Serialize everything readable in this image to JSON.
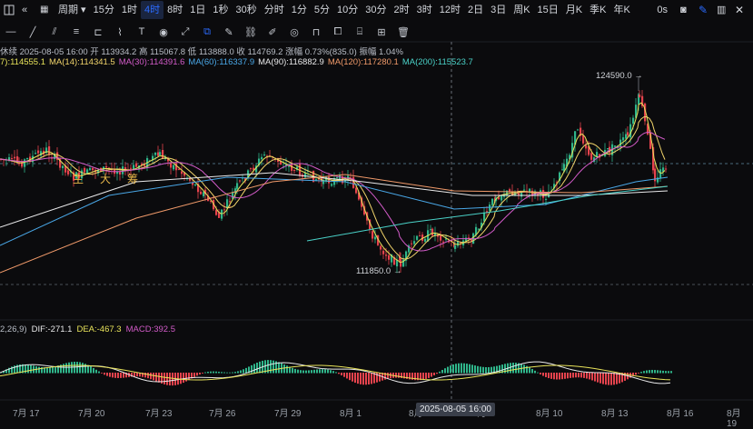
{
  "timeframes": [
    "周期",
    "15分",
    "1时",
    "4时",
    "8时",
    "1日",
    "1秒",
    "30秒",
    "分时",
    "1分",
    "5分",
    "10分",
    "30分",
    "2时",
    "3时",
    "12时",
    "2日",
    "3日",
    "周K",
    "15日",
    "月K",
    "季K",
    "年K"
  ],
  "active_timeframe_index": 3,
  "right_bar": {
    "seconds_label": "0s"
  },
  "info_line": "休续  2025-08-05 16:00  开 113934.2  高 115067.8  低 113888.0  收 114769.2  涨幅 0.73%(835.0)  振幅 1.04%",
  "ma_items": [
    {
      "label": "7):114555.1",
      "color": "#e8e35a"
    },
    {
      "label": "MA(14):114341.5",
      "color": "#f0d36a"
    },
    {
      "label": "MA(30):114391.6",
      "color": "#d25bc8"
    },
    {
      "label": "MA(60):116337.9",
      "color": "#4aa8e8"
    },
    {
      "label": "MA(90):116882.9",
      "color": "#e9e9ea"
    },
    {
      "label": "MA(120):117280.1",
      "color": "#f09a6a"
    },
    {
      "label": "MA(200):115523.7",
      "color": "#4ad2c8"
    }
  ],
  "chips": [
    "主",
    "大",
    "筹"
  ],
  "high_marker": "124590.0",
  "low_marker": "111850.0",
  "macd_items": [
    {
      "label": "2,26,9)",
      "color": "#b9bec7"
    },
    {
      "label": "DIF:-271.1",
      "color": "#e9e9ea"
    },
    {
      "label": "DEA:-467.3",
      "color": "#e8e35a"
    },
    {
      "label": "MACD:392.5",
      "color": "#d25bc8"
    }
  ],
  "x_labels": [
    "7月 17",
    "7月 20",
    "7月 23",
    "7月 26",
    "7月 29",
    "8月 1",
    "8月",
    "8月 7",
    "8月 10",
    "8月 13",
    "8月 16",
    "8月 19"
  ],
  "crosshair_label": "2025-08-05 16:00",
  "colors": {
    "up": "#2fb58a",
    "down": "#e5434d",
    "accent": "#2b6bff"
  },
  "chart_data": {
    "type": "candlestick",
    "title": "",
    "price_markers": {
      "high": 124590.0,
      "low": 111850.0
    },
    "current_bar": {
      "time": "2025-08-05 16:00",
      "open": 113934.2,
      "high": 115067.8,
      "low": 113888.0,
      "close": 114769.2,
      "change_pct": 0.73,
      "change": 835.0,
      "amplitude_pct": 1.04
    },
    "moving_averages": {
      "MA7": 114555.1,
      "MA14": 114341.5,
      "MA30": 114391.6,
      "MA60": 116337.9,
      "MA90": 116882.9,
      "MA120": 117280.1,
      "MA200": 115523.7
    },
    "macd": {
      "DIF": -271.1,
      "DEA": -467.3,
      "MACD": 392.5
    },
    "x_labels": [
      "7月 17",
      "7月 20",
      "7月 23",
      "7月 26",
      "7月 29",
      "8月 1",
      "8月 7",
      "8月 10",
      "8月 13",
      "8月 16",
      "8月 19"
    ]
  }
}
